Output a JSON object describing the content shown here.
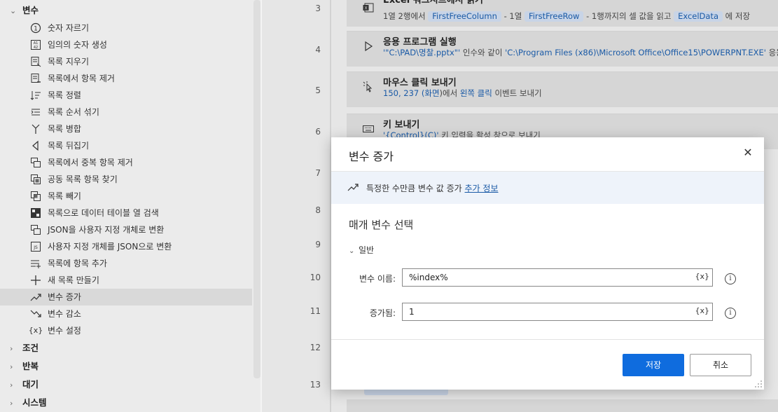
{
  "sidebar": {
    "category_open": "변수",
    "items": [
      {
        "label": "숫자 자르기",
        "icon": "number-one-icon"
      },
      {
        "label": "임의의 숫자 생성",
        "icon": "random-number-icon"
      },
      {
        "label": "목록 지우기",
        "icon": "list-clear-icon"
      },
      {
        "label": "목록에서 항목 제거",
        "icon": "list-remove-icon"
      },
      {
        "label": "목록 정렬",
        "icon": "list-sort-icon"
      },
      {
        "label": "목록 순서 섞기",
        "icon": "list-shuffle-icon"
      },
      {
        "label": "목록 병합",
        "icon": "list-merge-icon"
      },
      {
        "label": "목록 뒤집기",
        "icon": "list-reverse-icon"
      },
      {
        "label": "목록에서 중복 항목 제거",
        "icon": "list-dedupe-icon"
      },
      {
        "label": "공동 목록 항목 찾기",
        "icon": "list-common-icon"
      },
      {
        "label": "목록 빼기",
        "icon": "list-subtract-icon"
      },
      {
        "label": "목록으로 데이터 테이블 열 검색",
        "icon": "datatable-icon"
      },
      {
        "label": "JSON을 사용자 지정 개체로 변환",
        "icon": "json-to-object-icon"
      },
      {
        "label": "사용자 지정 개체를 JSON으로 변환",
        "icon": "object-to-json-icon"
      },
      {
        "label": "목록에 항목 추가",
        "icon": "list-add-icon"
      },
      {
        "label": "새 목록 만들기",
        "icon": "plus-icon"
      },
      {
        "label": "변수 증가",
        "icon": "trend-up-icon"
      },
      {
        "label": "변수 감소",
        "icon": "trend-down-icon"
      },
      {
        "label": "변수 설정",
        "icon": "variable-icon"
      }
    ],
    "categories_closed": [
      "조건",
      "반복",
      "대기",
      "시스템"
    ]
  },
  "flow": {
    "line_numbers": [
      "3",
      "4",
      "5",
      "6",
      "7",
      "8",
      "9",
      "10",
      "11",
      "12",
      "13"
    ],
    "steps": [
      {
        "title": "Excel 워크시트에서 읽기",
        "desc_parts": [
          "1열 2행에서 ",
          "FirstFreeColumn",
          " - 1열 ",
          "FirstFreeRow",
          " - 1행까지의 셀 값을 읽고 ",
          "ExcelData",
          " 에 저장"
        ]
      },
      {
        "title": "응용 프로그램 실행",
        "desc_parts": [
          "'\"C:\\PAD\\명찰.pptx\"'",
          " 인수와 같이 ",
          "'C:\\Program Files (x86)\\Microsoft Office\\Office15\\POWERPNT.EXE'",
          " 응용 프"
        ]
      },
      {
        "title": "마우스 클릭 보내기",
        "desc_parts": [
          "150, 237 (",
          "화면",
          ")에서 ",
          "왼쪽 클릭",
          " 이벤트 보내기"
        ]
      },
      {
        "title": "키 보내기",
        "desc_parts": [
          "'{Control}(C)'",
          " 키 입력을 활성 창으로 보내기"
        ]
      }
    ]
  },
  "dialog": {
    "title": "변수 증가",
    "info_text": "특정한 수만큼 변수 값 증가 ",
    "info_link": "추가 정보",
    "section_title": "매개 변수 선택",
    "group_label": "일반",
    "fields": [
      {
        "label": "변수 이름:",
        "value": "%index%",
        "var_button": "{x}"
      },
      {
        "label": "증가됨:",
        "value": "1",
        "var_button": "{x}"
      }
    ],
    "save_label": "저장",
    "cancel_label": "취소"
  }
}
